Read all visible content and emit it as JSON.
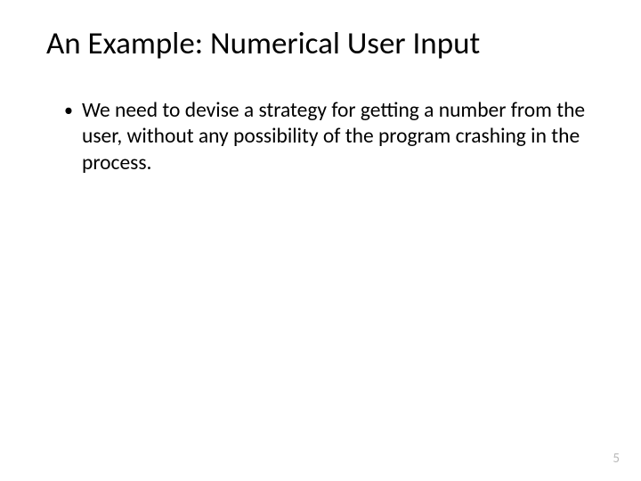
{
  "slide": {
    "title": "An Example: Numerical User Input",
    "bullets": [
      "We need to devise a strategy for getting a number from the user, without any possibility of the program crashing in the process."
    ],
    "page_number": "5"
  }
}
